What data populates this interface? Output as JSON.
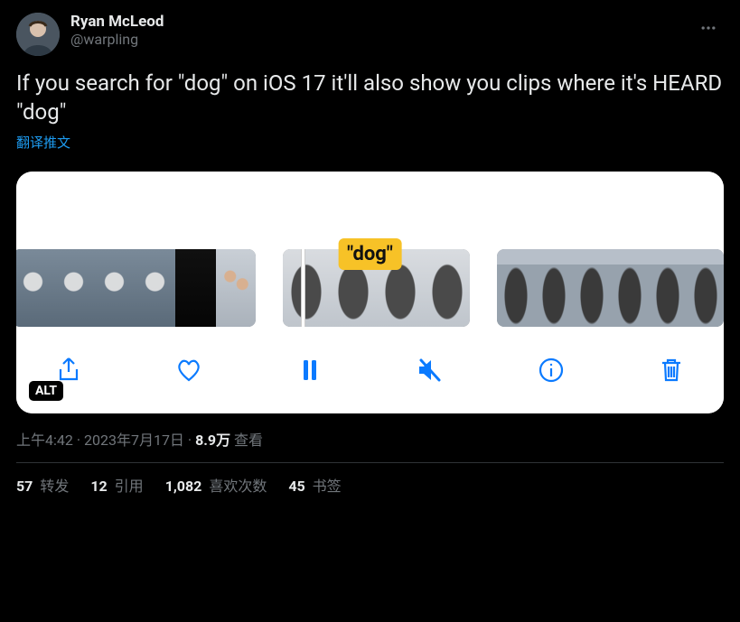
{
  "author": {
    "display_name": "Ryan McLeod",
    "handle": "@warpling"
  },
  "tweet_text": "If you search for \"dog\" on iOS 17 it'll also show you clips where it's HEARD \"dog\"",
  "translate_label": "翻译推文",
  "media": {
    "search_badge": "\"dog\"",
    "alt_badge": "ALT",
    "toolbar": {
      "share": "share",
      "like": "like",
      "pause": "pause",
      "mute": "mute",
      "info": "info",
      "delete": "delete"
    }
  },
  "meta": {
    "time": "上午4:42",
    "date": "2023年7月17日",
    "separator": " · ",
    "views_count": "8.9万",
    "views_label": " 查看"
  },
  "stats": {
    "retweets": {
      "count": "57",
      "label": " 转发"
    },
    "quotes": {
      "count": "12",
      "label": " 引用"
    },
    "likes": {
      "count": "1,082",
      "label": " 喜欢次数"
    },
    "bookmarks": {
      "count": "45",
      "label": " 书签"
    }
  }
}
